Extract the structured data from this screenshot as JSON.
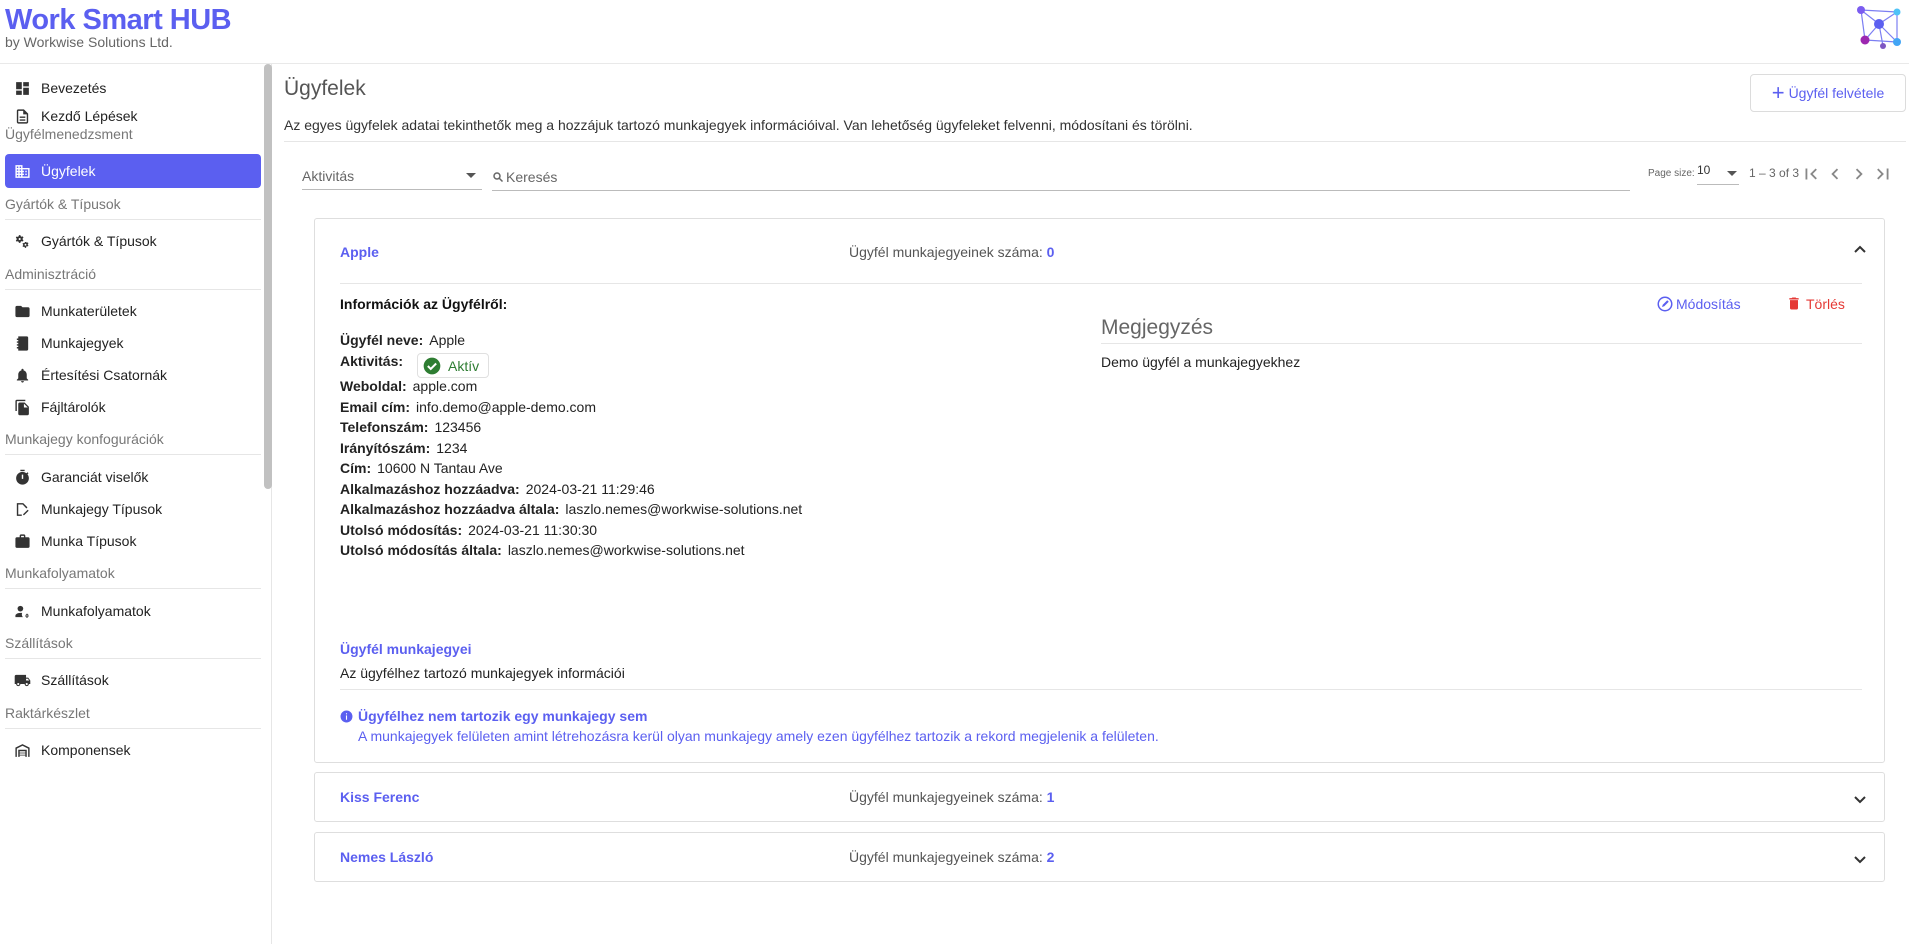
{
  "header": {
    "title": "Work Smart HUB",
    "subtitle": "by Workwise Solutions Ltd."
  },
  "sidebar": {
    "items": [
      {
        "label": "Bevezetés",
        "icon": "dashboard-icon"
      },
      {
        "label": "Kezdő Lépések",
        "icon": "document-icon"
      },
      {
        "section": "Ügyfélmenedzsment"
      },
      {
        "label": "Ügyfelek",
        "icon": "building-icon",
        "active": true
      },
      {
        "section": "Gyártók & Típusok"
      },
      {
        "label": "Gyártók & Típusok",
        "icon": "gears-icon"
      },
      {
        "section": "Adminisztráció"
      },
      {
        "label": "Munkaterületek",
        "icon": "folder-icon"
      },
      {
        "label": "Munkajegyek",
        "icon": "notebook-icon"
      },
      {
        "label": "Értesítési Csatornák",
        "icon": "bell-icon"
      },
      {
        "label": "Fájltárolók",
        "icon": "files-icon"
      },
      {
        "section": "Munkajegy konfogurációk"
      },
      {
        "label": "Garanciát viselők",
        "icon": "stopwatch-icon"
      },
      {
        "label": "Munkajegy Típusok",
        "icon": "tag-edit-icon"
      },
      {
        "label": "Munka Típusok",
        "icon": "briefcase-icon"
      },
      {
        "section": "Munkafolyamatok"
      },
      {
        "label": "Munkafolyamatok",
        "icon": "user-gear-icon"
      },
      {
        "section": "Szállítások"
      },
      {
        "label": "Szállítások",
        "icon": "truck-icon"
      },
      {
        "section": "Raktárkészlet"
      },
      {
        "label": "Komponensek",
        "icon": "warehouse-icon"
      }
    ]
  },
  "main": {
    "title": "Ügyfelek",
    "description": "Az egyes ügyfelek adatai tekinthetők meg a hozzájuk tartozó munkajegyek információival. Van lehetőség ügyfeleket felvenni, módosítani és törölni.",
    "add_button": "Ügyfél felvétele",
    "filter": {
      "label": "Aktivitás"
    },
    "search": {
      "placeholder": "Keresés"
    },
    "pager": {
      "label": "Page size:",
      "size": "10",
      "range": "1 – 3 of 3"
    }
  },
  "customers": [
    {
      "name": "Apple",
      "count_label": "Ügyfél munkajegyeinek száma:",
      "count": "0",
      "expanded": true,
      "info_title": "Információk az Ügyfélről:",
      "edit_label": "Módosítás",
      "delete_label": "Törlés",
      "fields": [
        {
          "key": "Ügyfél neve:",
          "value": "Apple"
        },
        {
          "key": "Aktivitás:",
          "value": "Aktív"
        },
        {
          "key": "Weboldal:",
          "value": "apple.com"
        },
        {
          "key": "Email cím:",
          "value": "info.demo@apple-demo.com"
        },
        {
          "key": "Telefonszám:",
          "value": "123456"
        },
        {
          "key": "Irányítószám:",
          "value": "1234"
        },
        {
          "key": "Cím:",
          "value": "10600 N Tantau Ave"
        },
        {
          "key": "Alkalmazáshoz hozzáadva:",
          "value": "2024-03-21 11:29:46"
        },
        {
          "key": "Alkalmazáshoz hozzáadva általa:",
          "value": "laszlo.nemes@workwise-solutions.net"
        },
        {
          "key": "Utolsó módosítás:",
          "value": "2024-03-21 11:30:30"
        },
        {
          "key": "Utolsó módosítás általa:",
          "value": "laszlo.nemes@workwise-solutions.net"
        }
      ],
      "note_title": "Megjegyzés",
      "note_text": "Demo ügyfél a munkajegyekhez",
      "tickets_title": "Ügyfél munkajegyei",
      "tickets_desc": "Az ügyfélhez tartozó munkajegyek információi",
      "empty_title": "Ügyfélhez nem tartozik egy munkajegy sem",
      "empty_desc": "A munkajegyek felületen amint létrehozásra kerül olyan munkajegy amely ezen ügyfélhez tartozik a rekord megjelenik a felületen."
    },
    {
      "name": "Kiss Ferenc",
      "count_label": "Ügyfél munkajegyeinek száma:",
      "count": "1",
      "expanded": false
    },
    {
      "name": "Nemes László",
      "count_label": "Ügyfél munkajegyeinek száma:",
      "count": "2",
      "expanded": false
    }
  ],
  "colors": {
    "accent": "#5b5ff0",
    "danger": "#e53935",
    "success": "#2e7d32"
  }
}
